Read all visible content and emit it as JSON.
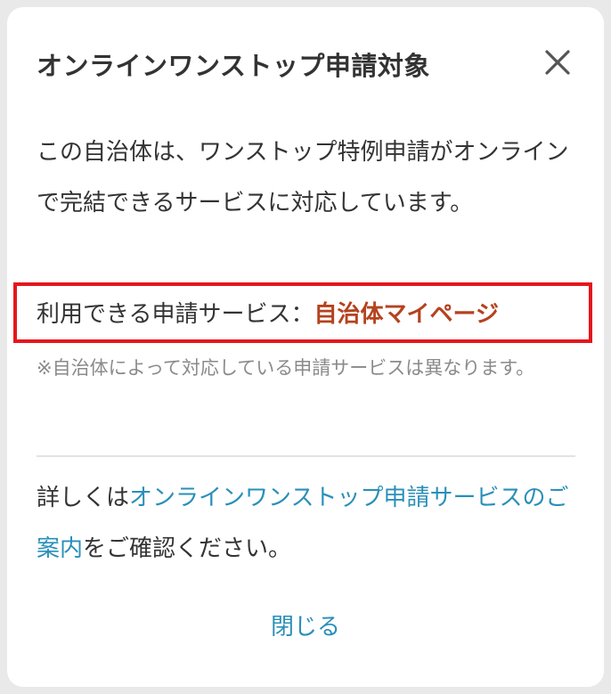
{
  "dialog": {
    "title": "オンラインワンストップ申請対象",
    "close_icon": "close-icon",
    "description": "この自治体は、ワンストップ特例申請がオンラインで完結できるサービスに対応しています。",
    "service": {
      "label": "利用できる申請サービス：",
      "value": "自治体マイページ"
    },
    "note": "※自治体によって対応している申請サービスは異なります。",
    "detail": {
      "prefix": "詳しくは",
      "link_text": "オンラインワンストップ申請サービスのご案内",
      "suffix": "をご確認ください。"
    },
    "close_button_label": "閉じる"
  },
  "colors": {
    "text": "#333333",
    "muted": "#8a8a8a",
    "link": "#2a8fb8",
    "service_value": "#b5421e",
    "highlight_border": "#e5161c"
  }
}
